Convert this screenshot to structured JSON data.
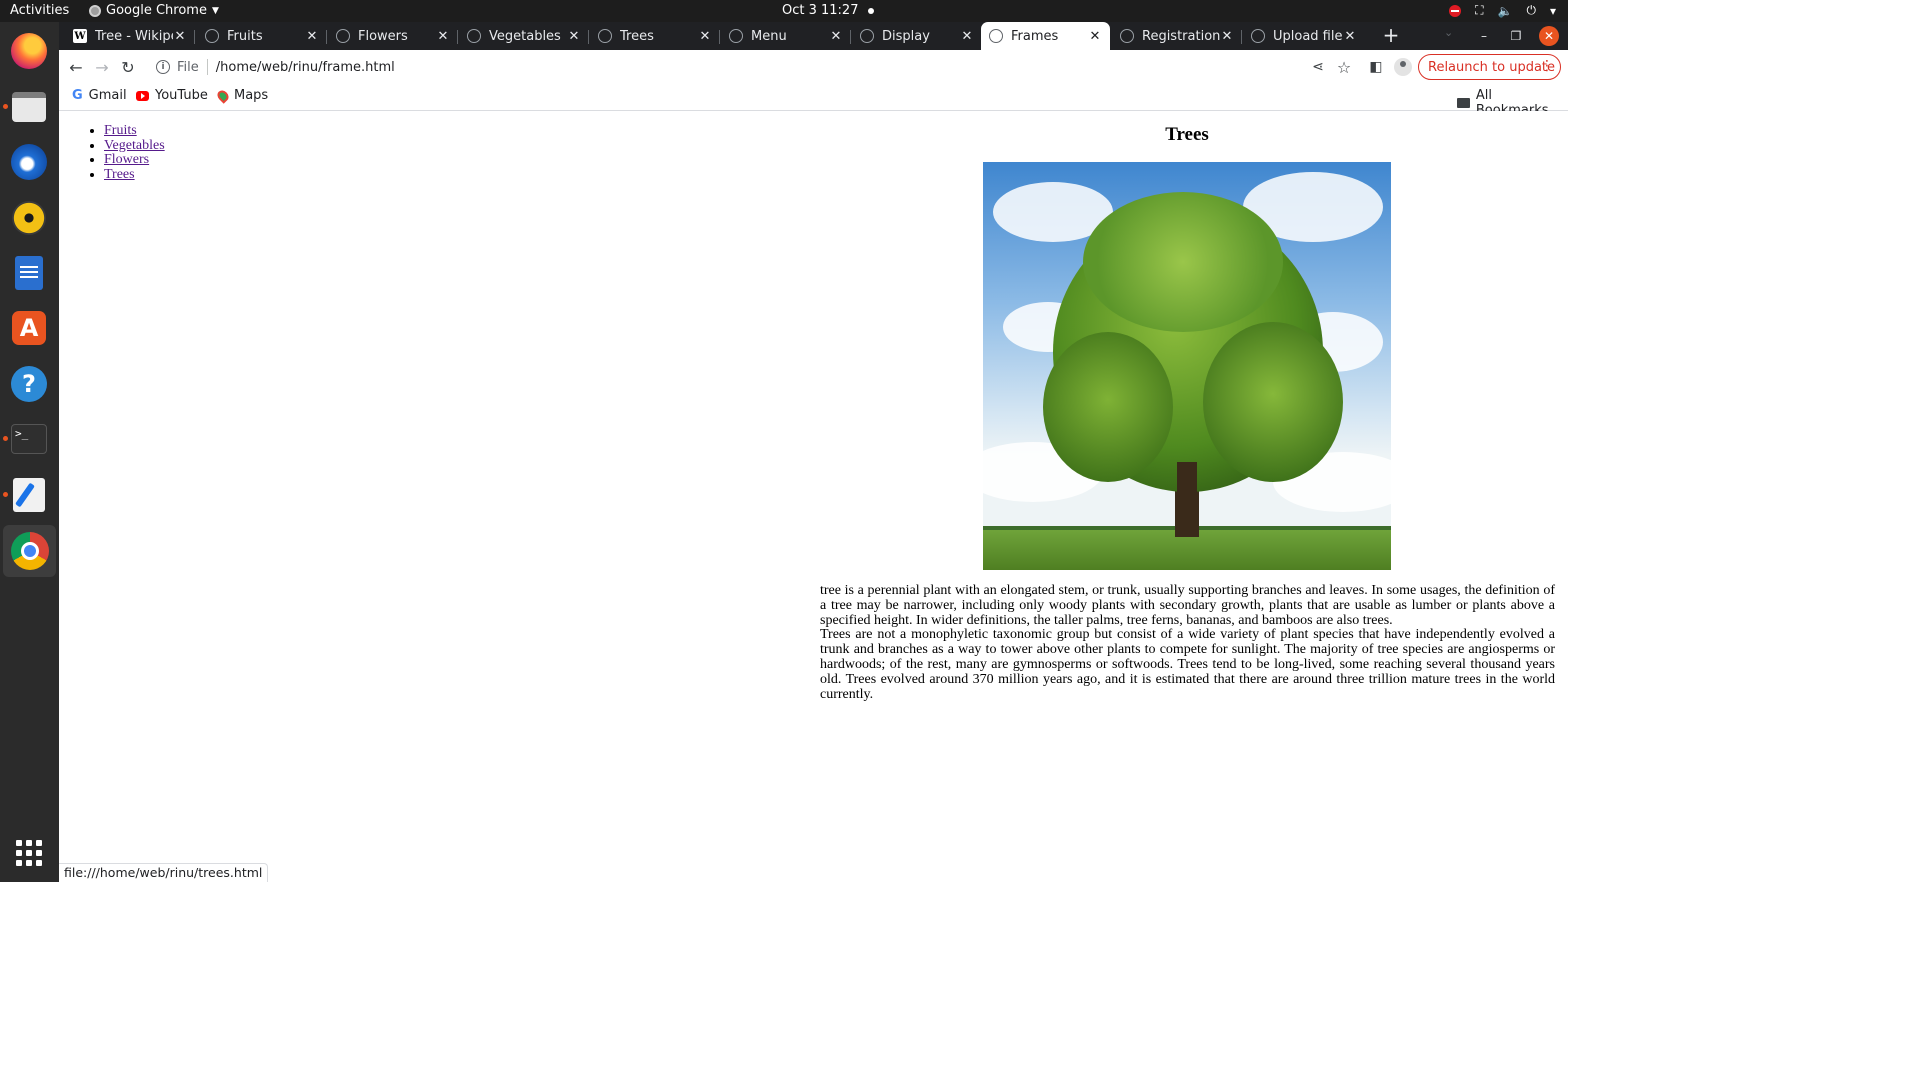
{
  "topbar": {
    "activities": "Activities",
    "app_name": "Google Chrome",
    "clock": "Oct 3  11:27"
  },
  "dock": {
    "items": [
      "firefox-icon",
      "files-icon",
      "thunderbird-icon",
      "rhythmbox-icon",
      "libreoffice-writer-icon",
      "app-center-icon",
      "help-icon",
      "terminal-icon",
      "text-editor-icon",
      "chrome-icon",
      "show-apps-icon"
    ]
  },
  "tabs": [
    {
      "title": "Tree - Wikipedia",
      "icon": "wikipedia-icon"
    },
    {
      "title": "Fruits",
      "icon": "globe-icon"
    },
    {
      "title": "Flowers",
      "icon": "globe-icon"
    },
    {
      "title": "Vegetables",
      "icon": "globe-icon"
    },
    {
      "title": "Trees",
      "icon": "globe-icon"
    },
    {
      "title": "Menu",
      "icon": "globe-icon"
    },
    {
      "title": "Display",
      "icon": "globe-icon"
    },
    {
      "title": "Frames",
      "icon": "globe-icon",
      "active": true
    },
    {
      "title": "Registration form",
      "icon": "globe-icon"
    },
    {
      "title": "Upload files",
      "icon": "loading-icon"
    }
  ],
  "toolbar": {
    "scheme": "File",
    "url": "/home/web/rinu/frame.html",
    "relaunch": "Relaunch to update"
  },
  "bookmarks": {
    "items": [
      "Gmail",
      "YouTube",
      "Maps"
    ],
    "all": "All Bookmarks"
  },
  "page": {
    "nav_links": [
      "Fruits",
      "Vegetables",
      "Flowers",
      "Trees"
    ],
    "heading": "Trees",
    "paragraph1": "tree is a perennial plant with an elongated stem, or trunk, usually supporting branches and leaves. In some usages, the definition of a tree may be narrower, including only woody plants with secondary growth, plants that are usable as lumber or plants above a specified height. In wider definitions, the taller palms, tree ferns, bananas, and bamboos are also trees.",
    "paragraph2": "Trees are not a monophyletic taxonomic group but consist of a wide variety of plant species that have independently evolved a trunk and branches as a way to tower above other plants to compete for sunlight. The majority of tree species are angiosperms or hardwoods; of the rest, many are gymnosperms or softwoods. Trees tend to be long-lived, some reaching several thousand years old. Trees evolved around 370 million years ago, and it is estimated that there are around three trillion mature trees in the world currently."
  },
  "status": {
    "hover_url": "file:///home/web/rinu/trees.html"
  },
  "colors": {
    "accent": "#e95420",
    "link_visited": "#551a8b",
    "relaunch": "#d93025"
  }
}
